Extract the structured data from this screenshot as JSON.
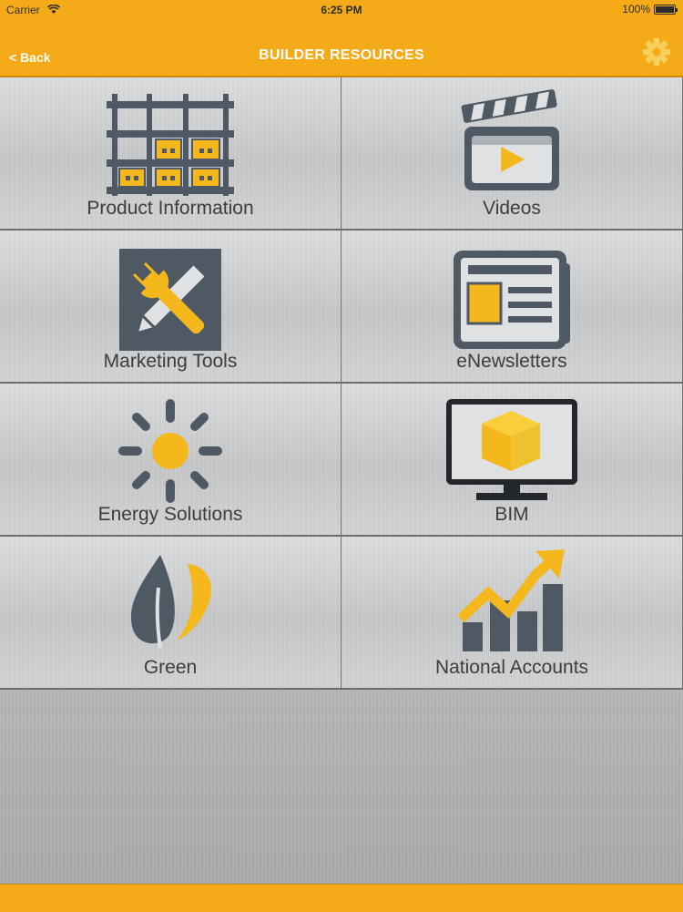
{
  "status_bar": {
    "carrier": "Carrier",
    "time": "6:25 PM",
    "battery": "100%"
  },
  "nav": {
    "back_label": "< Back",
    "title": "BUILDER RESOURCES",
    "settings_icon": "gear-icon"
  },
  "tiles": [
    {
      "label": "Product Information",
      "icon": "product-grid-icon"
    },
    {
      "label": "Videos",
      "icon": "clapperboard-icon"
    },
    {
      "label": "Marketing Tools",
      "icon": "tools-icon"
    },
    {
      "label": "eNewsletters",
      "icon": "newspaper-icon"
    },
    {
      "label": "Energy Solutions",
      "icon": "sun-icon"
    },
    {
      "label": "BIM",
      "icon": "monitor-cube-icon"
    },
    {
      "label": "Green",
      "icon": "leaf-icon"
    },
    {
      "label": "National Accounts",
      "icon": "growth-chart-icon"
    }
  ],
  "colors": {
    "accent": "#f4ab17",
    "icon_dark": "#4e5963",
    "icon_yellow": "#f5b81c"
  }
}
